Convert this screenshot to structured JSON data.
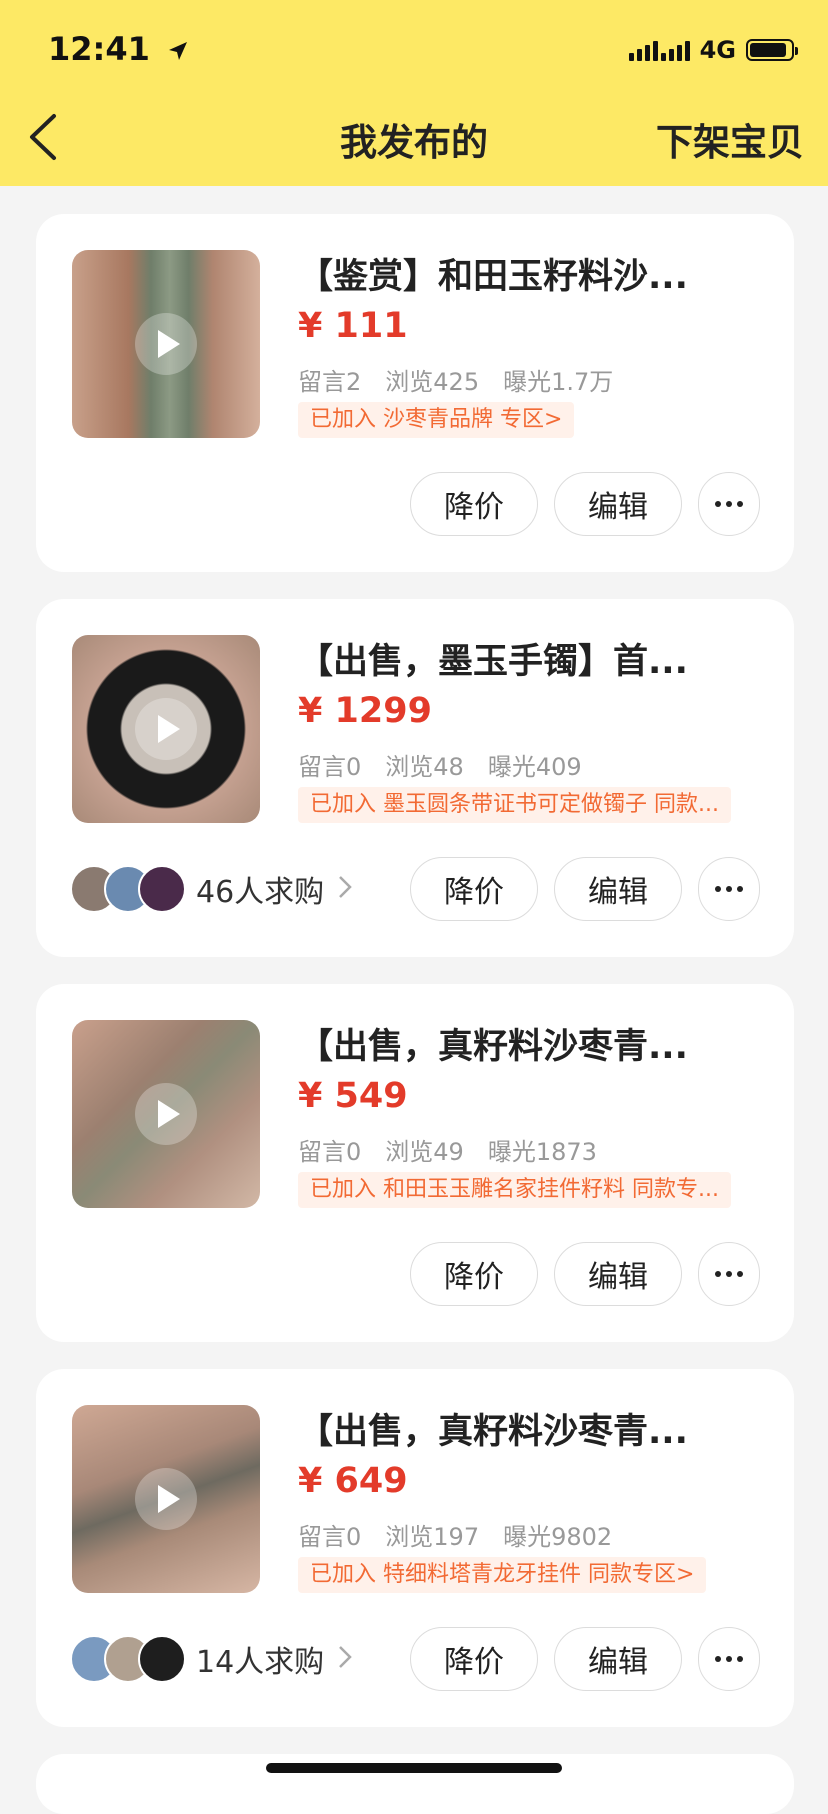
{
  "status_bar": {
    "time": "12:41",
    "network": "4G"
  },
  "nav": {
    "title": "我发布的",
    "right_action": "下架宝贝"
  },
  "actions": {
    "reduce_price": "降价",
    "edit": "编辑"
  },
  "listings": [
    {
      "title": "【鉴赏】和田玉籽料沙...",
      "price": "¥ 111",
      "comments": "留言2",
      "views": "浏览425",
      "exposure": "曝光1.7万",
      "tag": "已加入 沙枣青品牌 专区>",
      "wanters": null
    },
    {
      "title": "【出售，墨玉手镯】首...",
      "price": "¥ 1299",
      "comments": "留言0",
      "views": "浏览48",
      "exposure": "曝光409",
      "tag": "已加入 墨玉圆条带证书可定做镯子 同款...",
      "wanters": "46人求购"
    },
    {
      "title": "【出售，真籽料沙枣青...",
      "price": "¥ 549",
      "comments": "留言0",
      "views": "浏览49",
      "exposure": "曝光1873",
      "tag": "已加入 和田玉玉雕名家挂件籽料 同款专...",
      "wanters": null
    },
    {
      "title": "【出售，真籽料沙枣青...",
      "price": "¥ 649",
      "comments": "留言0",
      "views": "浏览197",
      "exposure": "曝光9802",
      "tag": "已加入 特细料塔青龙牙挂件 同款专区>",
      "wanters": "14人求购"
    }
  ],
  "colors": {
    "header_bg": "#fde965",
    "price": "#e33b2a",
    "tag_text": "#f26a34",
    "tag_bg": "#fff1ea"
  }
}
